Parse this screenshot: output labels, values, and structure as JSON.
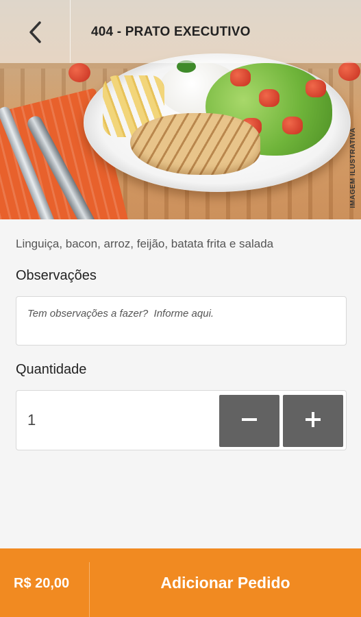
{
  "header": {
    "title": "404 - PRATO EXECUTIVO",
    "back_icon": "chevron-left-icon"
  },
  "hero": {
    "caption": "IMAGEM ILUSTRATIVA"
  },
  "product": {
    "description": "Linguiça, bacon, arroz, feijão, batata frita e salada"
  },
  "observations": {
    "label": "Observações",
    "value": "",
    "placeholder": "Tem observações a fazer?  Informe aqui."
  },
  "quantity": {
    "label": "Quantidade",
    "value": "1",
    "decrement_icon": "minus-icon",
    "increment_icon": "plus-icon"
  },
  "footer": {
    "price": "R$ 20,00",
    "add_label": "Adicionar Pedido"
  },
  "colors": {
    "accent": "#f18a21",
    "button_gray": "#626262",
    "background": "#f5f5f5"
  }
}
